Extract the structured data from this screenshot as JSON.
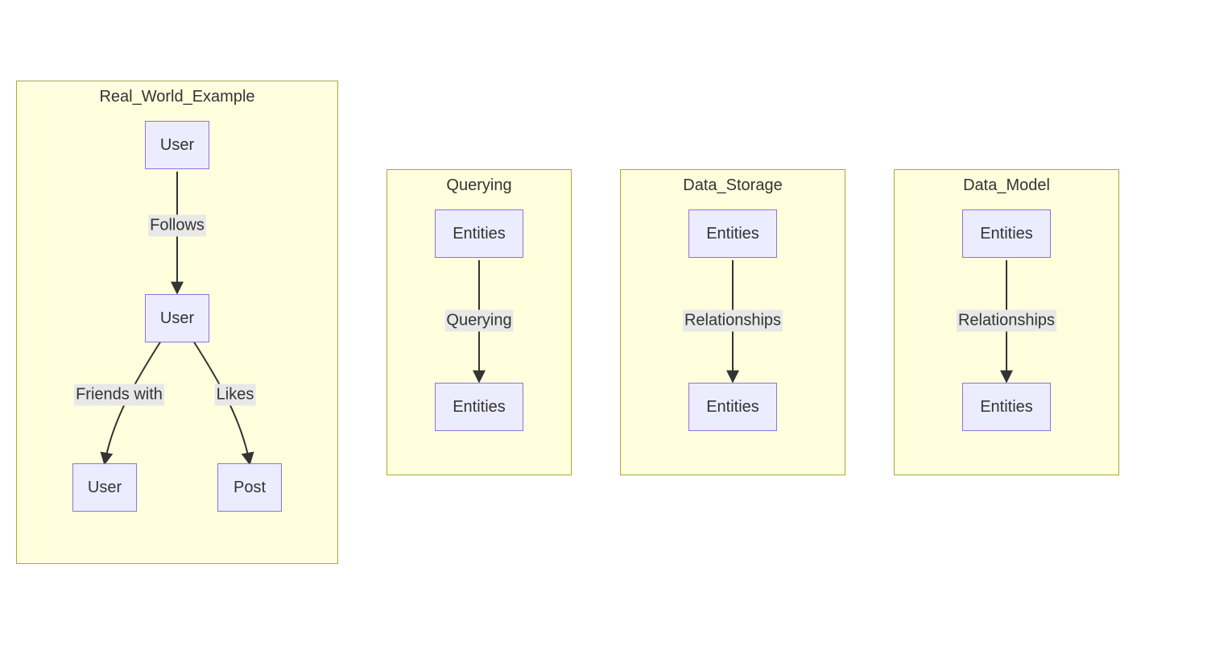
{
  "subgraphs": {
    "real_world": {
      "title": "Real_World_Example"
    },
    "querying": {
      "title": "Querying"
    },
    "storage": {
      "title": "Data_Storage"
    },
    "model": {
      "title": "Data_Model"
    }
  },
  "nodes": {
    "rw_user_top": "User",
    "rw_user_mid": "User",
    "rw_user_left": "User",
    "rw_post": "Post",
    "q_entities_top": "Entities",
    "q_entities_bot": "Entities",
    "s_entities_top": "Entities",
    "s_entities_bot": "Entities",
    "m_entities_top": "Entities",
    "m_entities_bot": "Entities"
  },
  "edges": {
    "rw_follows": "Follows",
    "rw_friends": "Friends with",
    "rw_likes": "Likes",
    "q_querying": "Querying",
    "s_relationships": "Relationships",
    "m_relationships": "Relationships"
  }
}
